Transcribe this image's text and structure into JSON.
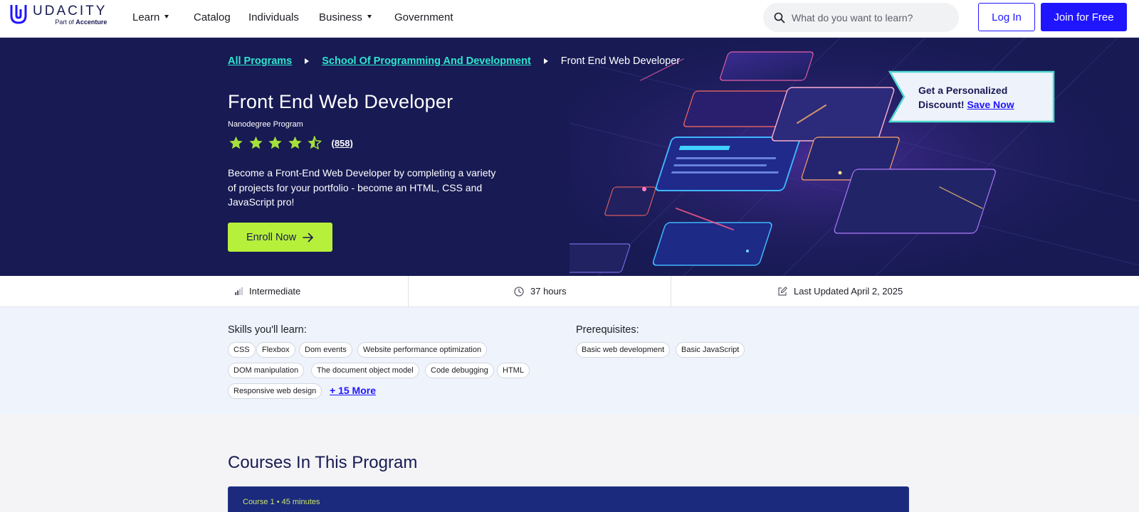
{
  "brand": {
    "name": "UDACITY",
    "sub_prefix": "Part of",
    "sub_bold": "Accenture"
  },
  "nav": {
    "learn": "Learn",
    "catalog": "Catalog",
    "individuals": "Individuals",
    "business": "Business",
    "government": "Government"
  },
  "search": {
    "placeholder": "What do you want to learn?"
  },
  "auth": {
    "login": "Log In",
    "join": "Join for Free"
  },
  "breadcrumb": {
    "item1": "All Programs",
    "item2": "School Of Programming And Development",
    "current": "Front End Web Developer"
  },
  "hero": {
    "title": "Front End Web Developer",
    "subtitle": "Nanodegree Program",
    "rating": 4.5,
    "rating_count": "(858)",
    "description": "Become a Front-End Web Developer by completing a variety of projects for your portfolio - become an HTML, CSS and JavaScript pro!",
    "enroll": "Enroll Now"
  },
  "discount": {
    "line1": "Get a Personalized",
    "line2": "Discount!",
    "link": "Save Now"
  },
  "meta": {
    "level": "Intermediate",
    "duration": "37 hours",
    "updated": "Last Updated April 2, 2025"
  },
  "skills": {
    "title": "Skills you'll learn:",
    "items": [
      "CSS",
      "Flexbox",
      "Dom events",
      "Website performance optimization",
      "DOM manipulation",
      "The document object model",
      "Code debugging",
      "HTML",
      "Responsive web design"
    ],
    "more": "+ 15 More"
  },
  "prereq": {
    "title": "Prerequisites:",
    "items": [
      "Basic web development",
      "Basic JavaScript"
    ]
  },
  "courses": {
    "title": "Courses In This Program",
    "first_meta": "Course 1 • 45 minutes"
  },
  "colors": {
    "brand_blue": "#2015ff",
    "hero_navy": "#171a53",
    "accent_lime": "#b7f03a",
    "link_teal": "#2ee6cf",
    "star_green": "#a5e03b"
  }
}
